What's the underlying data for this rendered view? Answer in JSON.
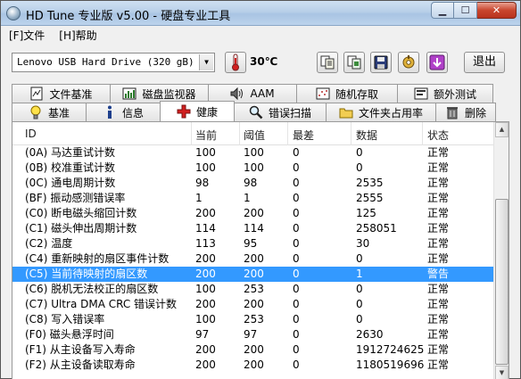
{
  "window": {
    "title": "HD Tune 专业版 v5.00 - 硬盘专业工具"
  },
  "menu": [
    {
      "label": "[F]文件"
    },
    {
      "label": "[H]帮助"
    }
  ],
  "toolbar": {
    "drive": "Lenovo  USB Hard Drive (320 gB)",
    "temperature": "30℃",
    "exit_label": "退出"
  },
  "tabs_row1": [
    {
      "label": "文件基准",
      "icon": "file-benchmark-icon"
    },
    {
      "label": "磁盘监视器",
      "icon": "disk-monitor-icon"
    },
    {
      "label": "AAM",
      "icon": "speaker-icon"
    },
    {
      "label": "随机存取",
      "icon": "random-access-icon"
    },
    {
      "label": "额外测试",
      "icon": "extra-tests-icon"
    }
  ],
  "tabs_row2": [
    {
      "label": "基准",
      "icon": "lightbulb-icon"
    },
    {
      "label": "信息",
      "icon": "info-icon"
    },
    {
      "label": "健康",
      "icon": "health-cross-icon"
    },
    {
      "label": "错误扫描",
      "icon": "magnifier-icon"
    },
    {
      "label": "文件夹占用率",
      "icon": "folder-icon"
    },
    {
      "label": "删除",
      "icon": "trash-icon"
    }
  ],
  "active_tab": "健康",
  "table": {
    "columns": [
      "ID",
      "当前",
      "阈值",
      "最差",
      "数据",
      "状态"
    ],
    "rows": [
      {
        "id": "(0A) 马达重试计数",
        "current": "100",
        "threshold": "100",
        "worst": "0",
        "data": "0",
        "status": "正常"
      },
      {
        "id": "(0B) 校准重试计数",
        "current": "100",
        "threshold": "100",
        "worst": "0",
        "data": "0",
        "status": "正常"
      },
      {
        "id": "(0C) 通电周期计数",
        "current": "98",
        "threshold": "98",
        "worst": "0",
        "data": "2535",
        "status": "正常"
      },
      {
        "id": "(BF) 振动感测错误率",
        "current": "1",
        "threshold": "1",
        "worst": "0",
        "data": "2555",
        "status": "正常"
      },
      {
        "id": "(C0) 断电磁头缩回计数",
        "current": "200",
        "threshold": "200",
        "worst": "0",
        "data": "125",
        "status": "正常"
      },
      {
        "id": "(C1) 磁头伸出周期计数",
        "current": "114",
        "threshold": "114",
        "worst": "0",
        "data": "258051",
        "status": "正常"
      },
      {
        "id": "(C2) 温度",
        "current": "113",
        "threshold": "95",
        "worst": "0",
        "data": "30",
        "status": "正常"
      },
      {
        "id": "(C4) 重新映射的扇区事件计数",
        "current": "200",
        "threshold": "200",
        "worst": "0",
        "data": "0",
        "status": "正常"
      },
      {
        "id": "(C5) 当前待映射的扇区数",
        "current": "200",
        "threshold": "200",
        "worst": "0",
        "data": "1",
        "status": "警告"
      },
      {
        "id": "(C6) 脱机无法校正的扇区数",
        "current": "100",
        "threshold": "253",
        "worst": "0",
        "data": "0",
        "status": "正常"
      },
      {
        "id": "(C7) Ultra DMA CRC 错误计数",
        "current": "200",
        "threshold": "200",
        "worst": "0",
        "data": "0",
        "status": "正常"
      },
      {
        "id": "(C8) 写入错误率",
        "current": "100",
        "threshold": "253",
        "worst": "0",
        "data": "0",
        "status": "正常"
      },
      {
        "id": "(F0) 磁头悬浮时间",
        "current": "97",
        "threshold": "97",
        "worst": "0",
        "data": "2630",
        "status": "正常"
      },
      {
        "id": "(F1) 从主设备写入寿命",
        "current": "200",
        "threshold": "200",
        "worst": "0",
        "data": "1912724625",
        "status": "正常"
      },
      {
        "id": "(F2) 从主设备读取寿命",
        "current": "200",
        "threshold": "200",
        "worst": "0",
        "data": "1180519696",
        "status": "正常"
      }
    ]
  },
  "colors": {
    "selection": "#3399ff",
    "title_bar": "#b8cfe8",
    "close_button": "#c9462e"
  }
}
